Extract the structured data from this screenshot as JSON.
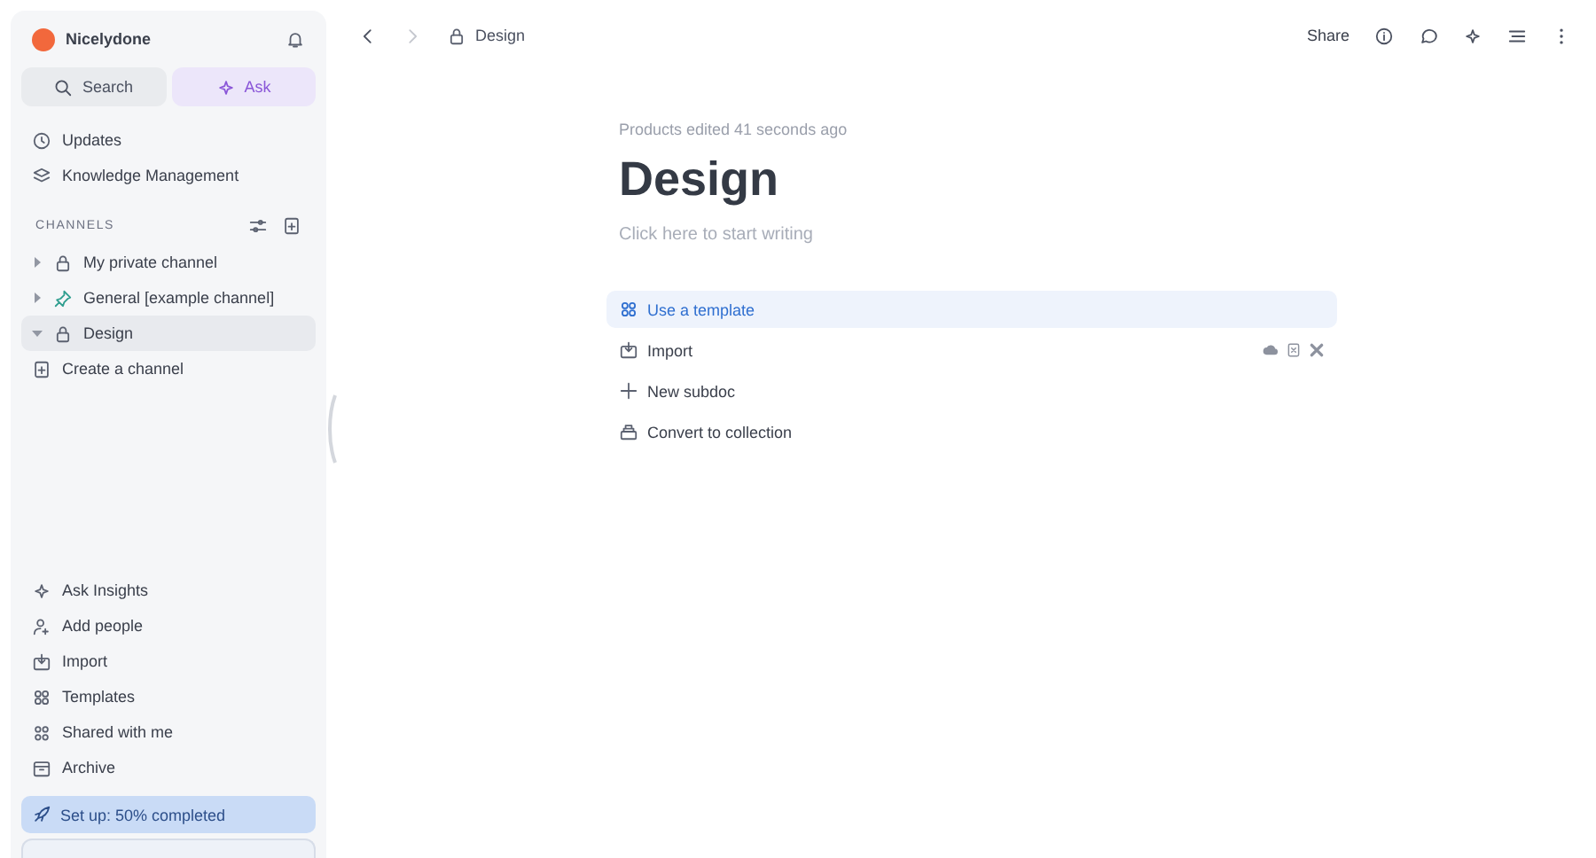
{
  "workspace": {
    "name": "Nicelydone"
  },
  "quick_actions": [
    {
      "label": "Search",
      "selected": false
    },
    {
      "label": "Ask",
      "selected": true
    }
  ],
  "nav": [
    "Updates",
    "Knowledge Management"
  ],
  "channels_heading": "CHANNELS",
  "channels": [
    {
      "name": "My private channel",
      "expanded": false,
      "selected": false
    },
    {
      "name": "General [example channel]",
      "expanded": false,
      "selected": false
    },
    {
      "name": "Design",
      "expanded": true,
      "selected": true
    }
  ],
  "create_channel": "Create a channel",
  "bottom_nav": [
    "Ask Insights",
    "Add people",
    "Import",
    "Templates",
    "Shared with me",
    "Archive"
  ],
  "setup": {
    "label": "Set up: 50% completed"
  },
  "breadcrumb": "Design",
  "share": "Share",
  "doc": {
    "meta": "Products edited 41 seconds ago",
    "title": "Design",
    "placeholder": "Click here to start writing"
  },
  "actions": [
    {
      "label": "Use a template",
      "selected": true
    },
    {
      "label": "Import",
      "selected": false
    },
    {
      "label": "New subdoc",
      "selected": false
    },
    {
      "label": "Convert to collection",
      "selected": false
    }
  ]
}
